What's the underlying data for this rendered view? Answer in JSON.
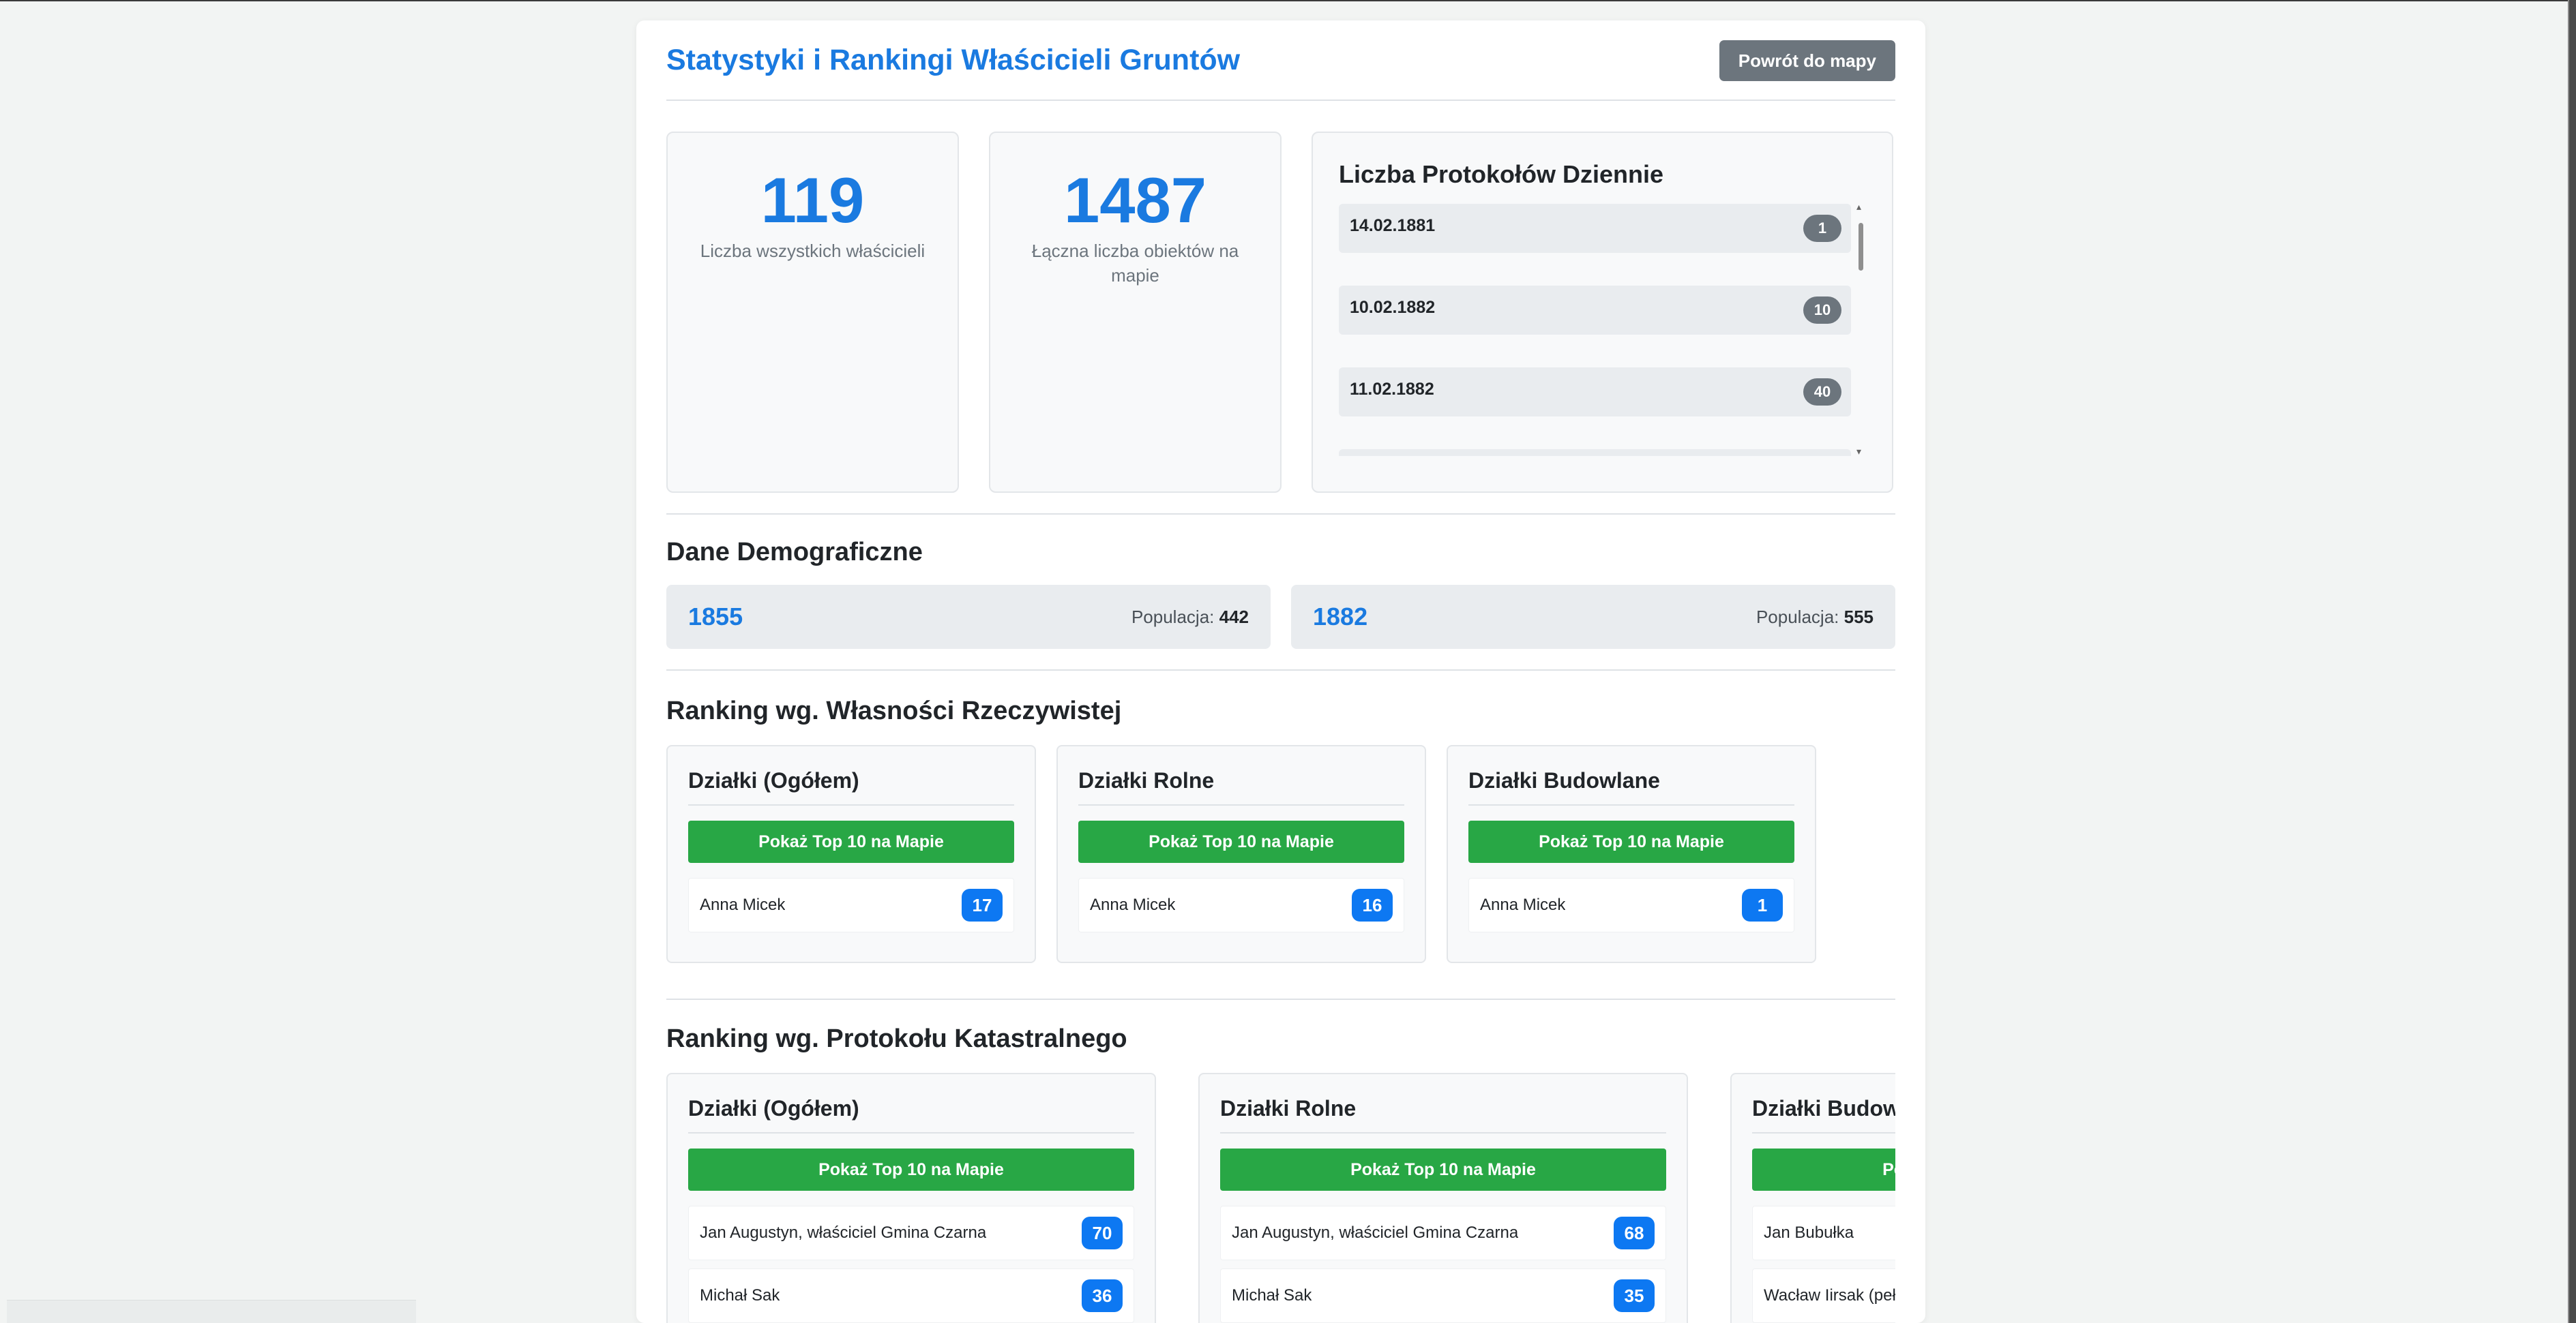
{
  "header": {
    "title": "Statystyki i Rankingi Właścicieli Gruntów",
    "back_button": "Powrót do mapy"
  },
  "stats": {
    "owners_count": "119",
    "owners_label": "Liczba wszystkich właścicieli",
    "objects_count": "1487",
    "objects_label": "Łączna liczba obiektów na mapie"
  },
  "daily": {
    "title": "Liczba Protokołów Dziennie",
    "items": [
      {
        "date": "14.02.1881",
        "count": "1"
      },
      {
        "date": "10.02.1882",
        "count": "10"
      },
      {
        "date": "11.02.1882",
        "count": "40"
      }
    ]
  },
  "demographics": {
    "title": "Dane Demograficzne",
    "population_label": "Populacja:",
    "entries": [
      {
        "year": "1855",
        "population": "442"
      },
      {
        "year": "1882",
        "population": "555"
      }
    ]
  },
  "ranking_actual": {
    "title": "Ranking wg. Własności Rzeczywistej",
    "button_label": "Pokaż Top 10 na Mapie",
    "cards": [
      {
        "title": "Działki (Ogółem)",
        "items": [
          {
            "name": "Anna Micek",
            "count": "17"
          }
        ]
      },
      {
        "title": "Działki Rolne",
        "items": [
          {
            "name": "Anna Micek",
            "count": "16"
          }
        ]
      },
      {
        "title": "Działki Budowlane",
        "items": [
          {
            "name": "Anna Micek",
            "count": "1"
          }
        ]
      }
    ]
  },
  "ranking_cadastral": {
    "title": "Ranking wg. Protokołu Katastralnego",
    "button_label": "Pokaż Top 10 na Mapie",
    "cards": [
      {
        "title": "Działki (Ogółem)",
        "items": [
          {
            "name": "Jan Augustyn, właściciel Gmina Czarna",
            "count": "70"
          },
          {
            "name": "Michał Sak",
            "count": "36"
          }
        ]
      },
      {
        "title": "Działki Rolne",
        "items": [
          {
            "name": "Jan Augustyn, właściciel Gmina Czarna",
            "count": "68"
          },
          {
            "name": "Michał Sak",
            "count": "35"
          }
        ]
      },
      {
        "title": "Działki Budowlane",
        "items": [
          {
            "name": "Jan Bubułka",
            "count": ""
          },
          {
            "name": "Wacław Iirsak (pełnomocnik",
            "count": ""
          }
        ]
      }
    ]
  }
}
